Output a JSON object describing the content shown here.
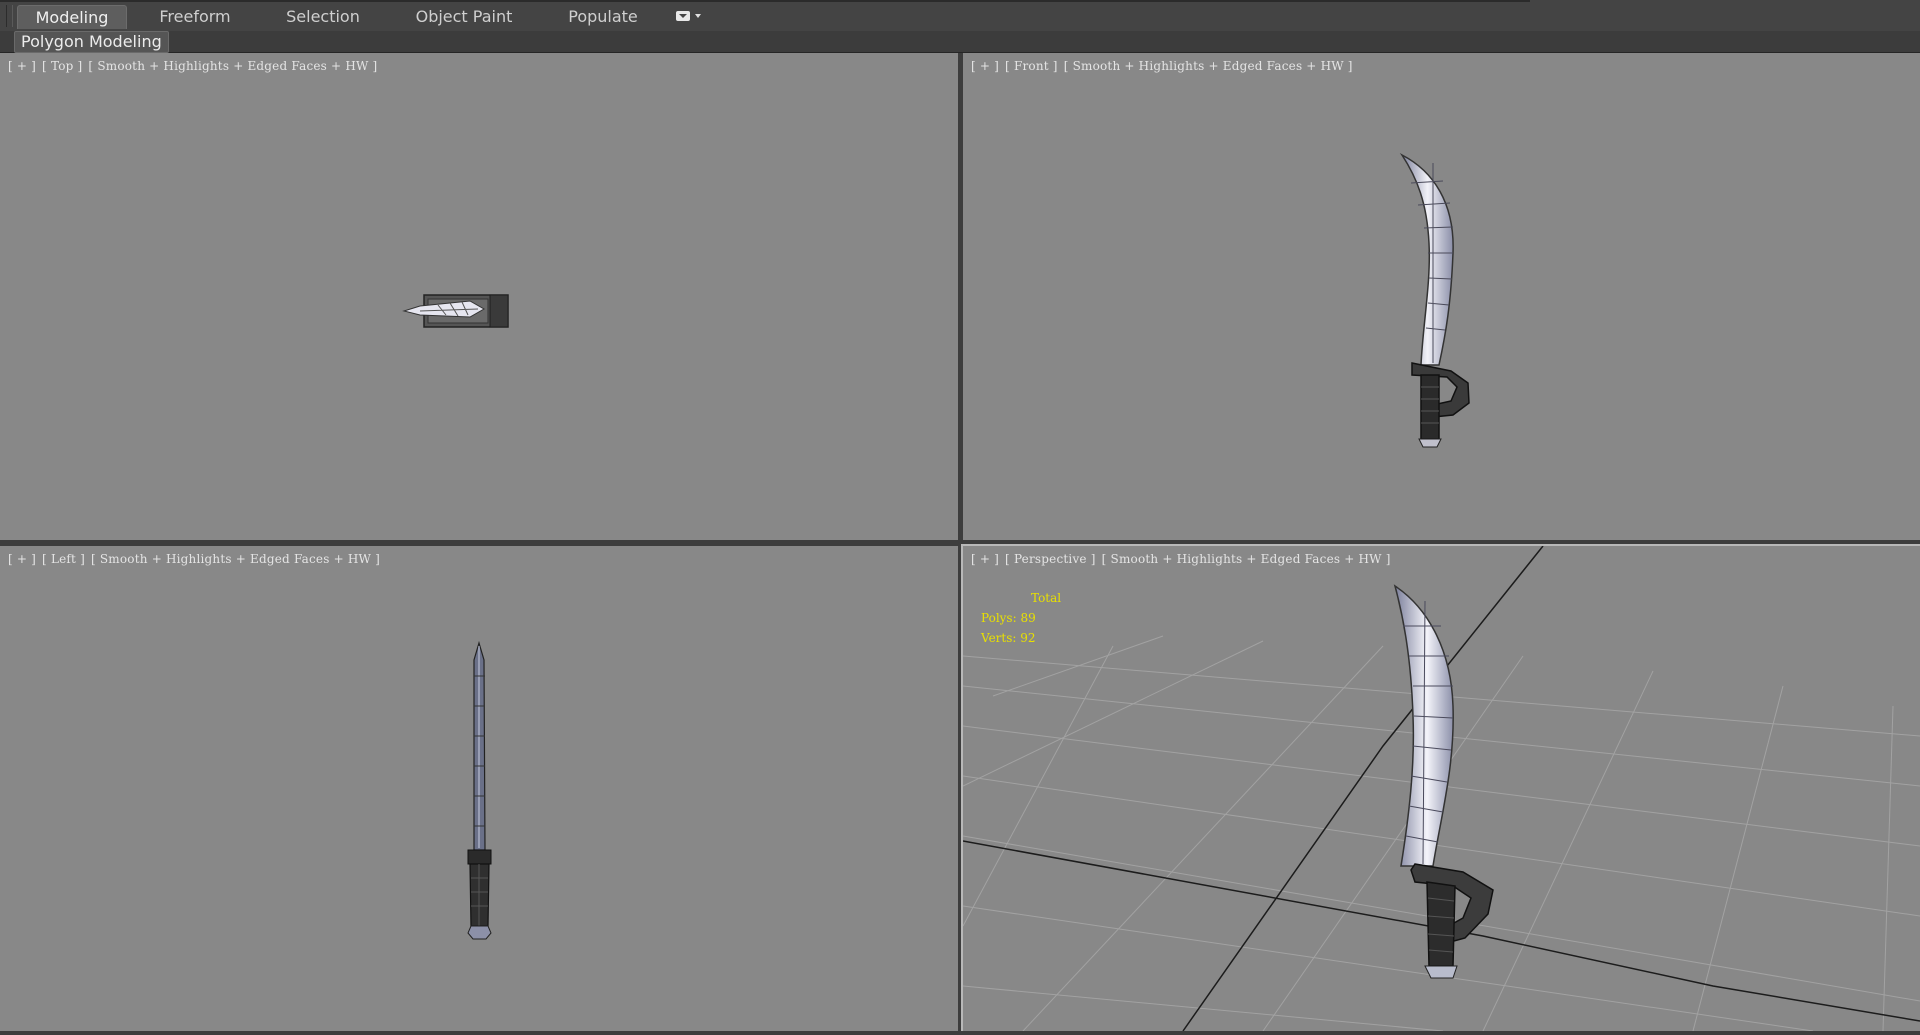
{
  "ribbon": {
    "tabs": [
      {
        "label": "Modeling",
        "active": true
      },
      {
        "label": "Freeform",
        "active": false
      },
      {
        "label": "Selection",
        "active": false
      },
      {
        "label": "Object Paint",
        "active": false
      },
      {
        "label": "Populate",
        "active": false
      }
    ],
    "options_icon": "ribbon-options-icon"
  },
  "subribbon": {
    "panel_label": "Polygon Modeling"
  },
  "viewports": {
    "top": {
      "plus": "[ + ]",
      "view": "[ Top ]",
      "shading": "[ Smooth + Highlights + Edged Faces + HW ]"
    },
    "front": {
      "plus": "[ + ]",
      "view": "[ Front ]",
      "shading": "[ Smooth + Highlights + Edged Faces + HW ]"
    },
    "left": {
      "plus": "[ + ]",
      "view": "[ Left ]",
      "shading": "[ Smooth + Highlights + Edged Faces + HW ]"
    },
    "perspective": {
      "plus": "[ + ]",
      "view": "[ Perspective ]",
      "shading": "[ Smooth + Highlights + Edged Faces + HW ]",
      "stats": {
        "title": "Total",
        "polys": "Polys: 89",
        "verts": "Verts: 92"
      }
    }
  },
  "colors": {
    "viewport_bg": "#888888",
    "stats_text": "#e8e000",
    "blade": "#c8c8d8",
    "handle": "#2e2e2e"
  }
}
